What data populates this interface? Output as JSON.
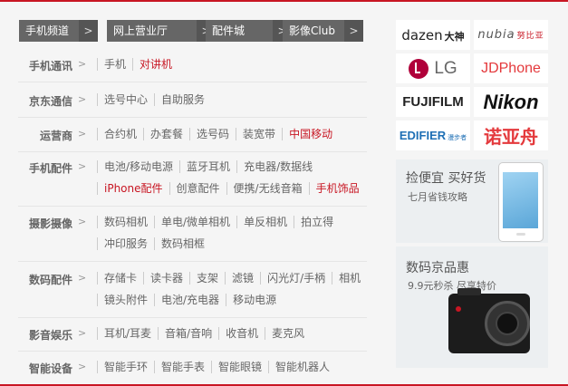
{
  "tabs": [
    {
      "label": "手机频道"
    },
    {
      "label": "网上营业厅"
    },
    {
      "label": "配件城"
    },
    {
      "label": "影像Club"
    }
  ],
  "tab_arrow": ">",
  "row_arrow": ">",
  "categories": [
    {
      "title": "手机通讯",
      "lines": [
        [
          {
            "t": "手机"
          },
          {
            "t": "对讲机",
            "red": true
          }
        ]
      ]
    },
    {
      "title": "京东通信",
      "lines": [
        [
          {
            "t": "选号中心"
          },
          {
            "t": "自助服务"
          }
        ]
      ]
    },
    {
      "title": "运营商",
      "lines": [
        [
          {
            "t": "合约机"
          },
          {
            "t": "办套餐"
          },
          {
            "t": "选号码"
          },
          {
            "t": "装宽带"
          },
          {
            "t": "中国移动",
            "red": true
          }
        ]
      ]
    },
    {
      "title": "手机配件",
      "lines": [
        [
          {
            "t": "电池/移动电源"
          },
          {
            "t": "蓝牙耳机"
          },
          {
            "t": "充电器/数据线"
          }
        ],
        [
          {
            "t": "iPhone配件",
            "red": true
          },
          {
            "t": "创意配件"
          },
          {
            "t": "便携/无线音箱"
          },
          {
            "t": "手机饰品",
            "red": true
          }
        ]
      ]
    },
    {
      "title": "摄影摄像",
      "lines": [
        [
          {
            "t": "数码相机"
          },
          {
            "t": "单电/微单相机"
          },
          {
            "t": "单反相机"
          },
          {
            "t": "拍立得"
          }
        ],
        [
          {
            "t": "冲印服务"
          },
          {
            "t": "数码相框"
          }
        ]
      ]
    },
    {
      "title": "数码配件",
      "lines": [
        [
          {
            "t": "存储卡"
          },
          {
            "t": "读卡器"
          },
          {
            "t": "支架"
          },
          {
            "t": "滤镜"
          },
          {
            "t": "闪光灯/手柄"
          },
          {
            "t": "相机"
          }
        ],
        [
          {
            "t": "镜头附件"
          },
          {
            "t": "电池/充电器"
          },
          {
            "t": "移动电源"
          }
        ]
      ]
    },
    {
      "title": "影音娱乐",
      "lines": [
        [
          {
            "t": "耳机/耳麦"
          },
          {
            "t": "音箱/音响"
          },
          {
            "t": "收音机"
          },
          {
            "t": "麦克风"
          }
        ]
      ]
    },
    {
      "title": "智能设备",
      "lines": [
        [
          {
            "t": "智能手环"
          },
          {
            "t": "智能手表"
          },
          {
            "t": "智能眼镜"
          },
          {
            "t": "智能机器人"
          }
        ]
      ]
    }
  ],
  "brands": {
    "dazen": {
      "text": "dazen",
      "sub": "大神"
    },
    "nubia": {
      "text": "nubia",
      "sub": "努比亚"
    },
    "lg": {
      "text": "LG"
    },
    "jdphone": {
      "text": "JDPhone"
    },
    "fujifilm": {
      "text": "FUJIFILM"
    },
    "nikon": {
      "text": "Nikon"
    },
    "edifier": {
      "text": "EDIFIER",
      "sub": "漫步者"
    },
    "nuoyazhou": {
      "text": "诺亚舟"
    }
  },
  "promos": [
    {
      "title": "捡便宜 买好货",
      "subtitle": "七月省钱攻略"
    },
    {
      "title": "数码京品惠",
      "subtitle": "9.9元秒杀 尽享特价"
    }
  ],
  "colors": {
    "accent": "#c81623",
    "tab_bg": "#666666"
  }
}
